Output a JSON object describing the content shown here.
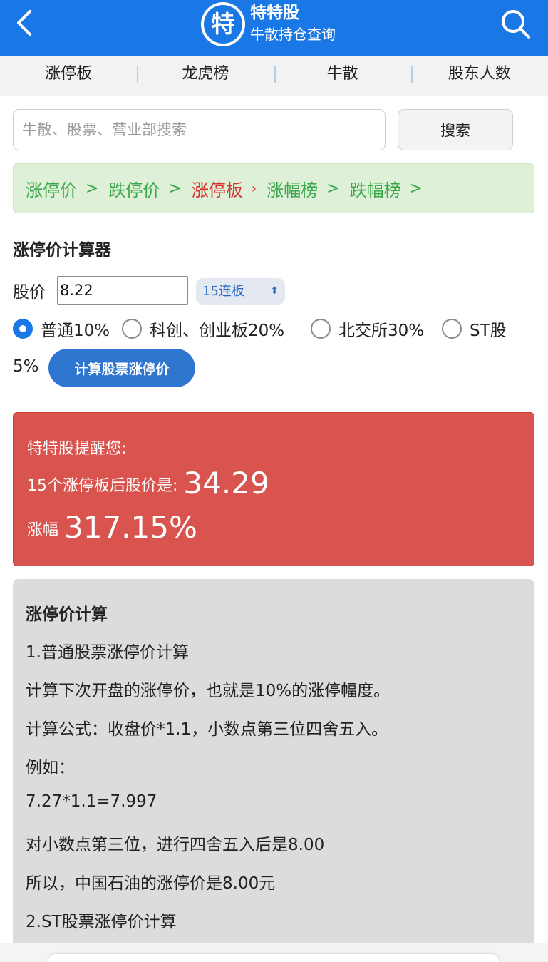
{
  "header": {
    "logo_char": "特",
    "title": "特特股",
    "subtitle": "牛散持仓查询",
    "icons": [
      "back-arrow-icon",
      "search-icon"
    ]
  },
  "nav": {
    "items": [
      {
        "label": "涨停板"
      },
      {
        "label": "龙虎榜"
      },
      {
        "label": "牛散"
      },
      {
        "label": "股东人数"
      }
    ]
  },
  "search": {
    "placeholder": "牛散、股票、营业部搜索",
    "button_label": "搜索"
  },
  "crumbs": {
    "items": [
      {
        "label": "涨停价",
        "sep": ">"
      },
      {
        "label": "跌停价",
        "sep": ">"
      },
      {
        "label": "涨停板",
        "sep": "›",
        "active": true
      },
      {
        "label": "涨幅榜",
        "sep": ">"
      },
      {
        "label": "跌幅榜",
        "sep": ">"
      }
    ]
  },
  "calculator": {
    "title": "涨停价计算器",
    "price_label": "股价",
    "price_value": "8.22",
    "board_selected": "15连板",
    "options": [
      {
        "label": "普通10%",
        "checked": true
      },
      {
        "label": "科创、创业板20%",
        "checked": false
      },
      {
        "label": "北交所30%",
        "checked": false
      },
      {
        "label": "ST股",
        "checked": false
      }
    ],
    "st_tail": "5%",
    "button_label": "计算股票涨停价"
  },
  "result": {
    "title": "特特股提醒您:",
    "line1_label": "15个涨停板后股价是:",
    "line1_value": "34.29",
    "line2_label": "涨幅",
    "line2_value": "317.15%"
  },
  "info": {
    "heading": "涨停价计算",
    "lines": [
      "1.普通股票涨停价计算",
      "计算下次开盘的涨停价，也就是10%的涨停幅度。",
      "计算公式：收盘价*1.1，小数点第三位四舍五入。",
      "例如：",
      "7.27*1.1=7.997",
      "对小数点第三位，进行四舍五入后是8.00",
      "所以，中国石油的涨停价是8.00元",
      "2.ST股票涨停价计算"
    ]
  },
  "colors": {
    "brand": "#1a78e6",
    "link_green": "#3aa84a",
    "link_active": "#d8302c",
    "result_bg": "#d9534f",
    "button_blue": "#2f76d1"
  }
}
